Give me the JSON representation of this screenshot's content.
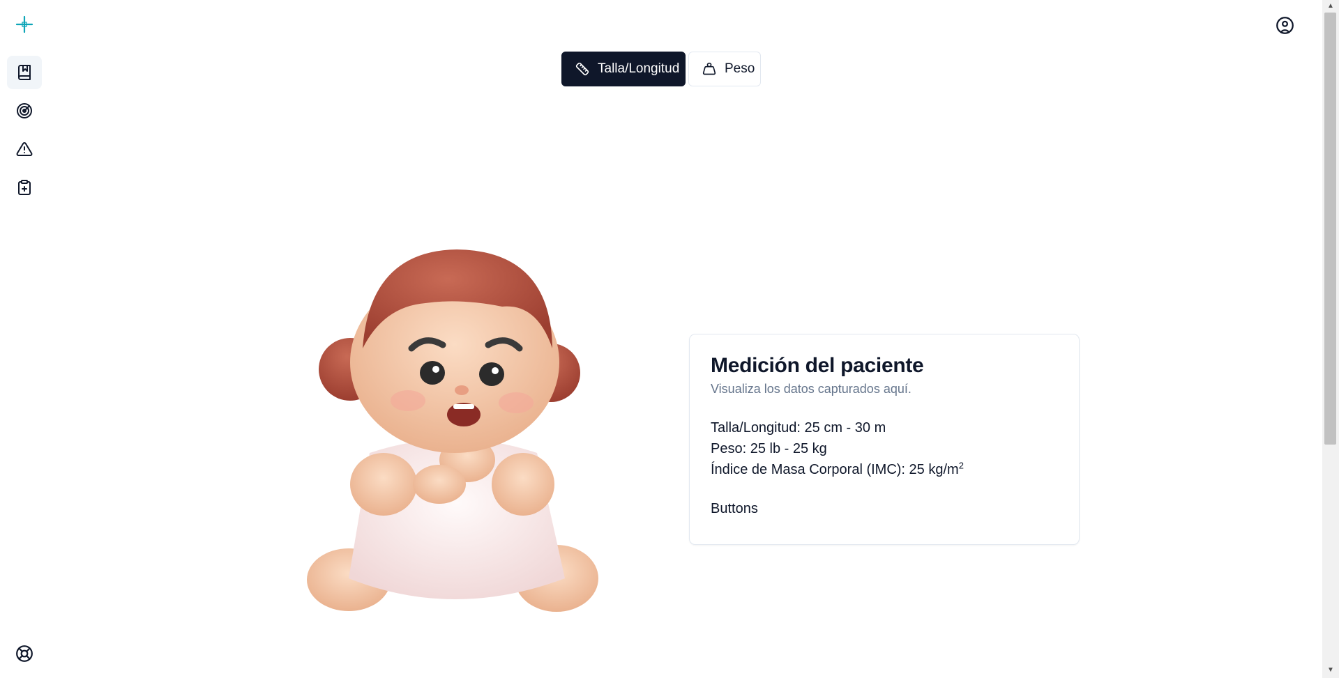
{
  "sidebar": {
    "logo_icon": "plus-cross-logo",
    "items": [
      {
        "name": "book-icon",
        "active": true
      },
      {
        "name": "radar-icon",
        "active": false
      },
      {
        "name": "alert-triangle-icon",
        "active": false
      },
      {
        "name": "clipboard-plus-icon",
        "active": false
      }
    ],
    "help_icon": "life-buoy-icon"
  },
  "header": {
    "user_icon": "user-circle-icon"
  },
  "tabs": [
    {
      "label": "Talla/Longitud",
      "icon": "ruler-icon",
      "active": true
    },
    {
      "label": "Peso",
      "icon": "weight-icon",
      "active": false
    }
  ],
  "card": {
    "title": "Medición del paciente",
    "subtitle": "Visualiza los datos capturados aquí.",
    "height_line": "Talla/Longitud: 25 cm - 30 m",
    "weight_line": "Peso: 25 lb - 25 kg",
    "bmi_line": "Índice de Masa Corporal (IMC): 25 kg/m",
    "bmi_superscript": "2",
    "buttons_label": "Buttons"
  },
  "colors": {
    "primary": "#0f172a",
    "muted": "#64748b",
    "border": "#e2e8f0",
    "logo": "#0ea5b7"
  }
}
